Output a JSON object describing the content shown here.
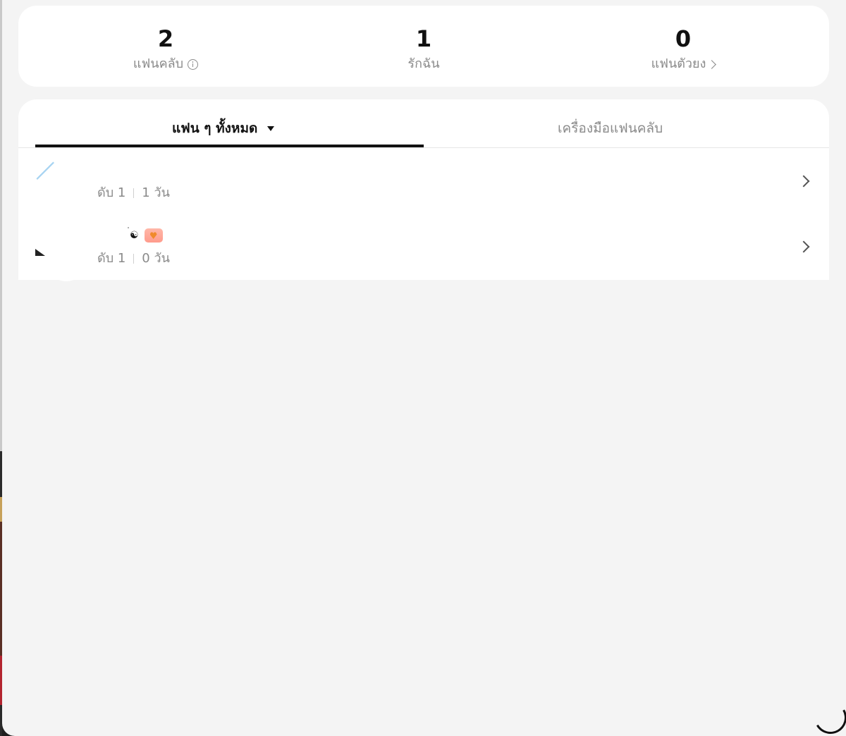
{
  "stats": [
    {
      "value": "2",
      "label": "แฟนคลับ",
      "icon": "info-icon"
    },
    {
      "value": "1",
      "label": "รักฉัน"
    },
    {
      "value": "0",
      "label": "แฟนตัวยง",
      "icon": "chevron-right-icon"
    }
  ],
  "tabs": {
    "active": "แฟน ๆ ทั้งหมด",
    "inactive": "เครื่องมือแฟนคลับ"
  },
  "fans": [
    {
      "level": "ดับ 1",
      "days": "1 วัน"
    },
    {
      "level": "ดับ 1",
      "days": "0 วัน",
      "badges": [
        "yin-yang-icon",
        "heart-badge-icon"
      ]
    }
  ],
  "colors": {
    "background": "#f4f4f4",
    "card": "#ffffff",
    "muted_text": "#8a8a8a",
    "primary_text": "#111111"
  }
}
